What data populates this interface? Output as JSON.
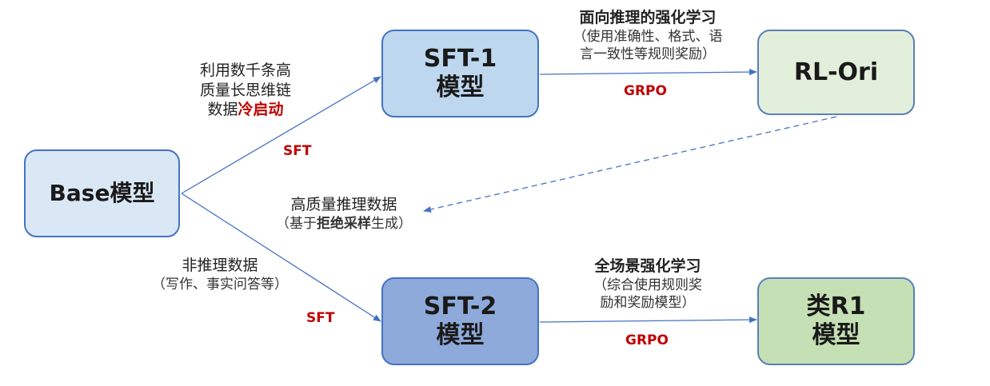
{
  "nodes": {
    "base": {
      "label": "Base模型"
    },
    "sft1": {
      "line1": "SFT-1",
      "line2": "模型"
    },
    "sft2": {
      "line1": "SFT-2",
      "line2": "模型"
    },
    "rl_ori": {
      "label": "RL-Ori"
    },
    "r1_like": {
      "line1": "类R1",
      "line2": "模型"
    }
  },
  "edges": {
    "base_to_sft1": {
      "line1": "利用数千条高",
      "line2": "质量长思维链",
      "line3_prefix": "数据",
      "line3_highlight": "冷启动",
      "method": "SFT"
    },
    "sft1_to_rlori": {
      "title": "面向推理的强化学习",
      "line1": "（使用准确性、格式、语",
      "line2": "言一致性等规则奖励）",
      "method": "GRPO"
    },
    "rlori_to_data": {
      "line1": "高质量推理数据",
      "line2_prefix": "（基于",
      "line2_bold": "拒绝采样",
      "line2_suffix": "生成）"
    },
    "base_to_sft2": {
      "line1": "非推理数据",
      "line2": "（写作、事实问答等）",
      "method": "SFT"
    },
    "sft2_to_r1": {
      "title": "全场景强化学习",
      "line1": "（综合使用规则奖",
      "line2": "励和奖励模型）",
      "method": "GRPO"
    }
  },
  "colors": {
    "border": "#4472c4",
    "arrow": "#4472c4",
    "highlight": "#c00000",
    "base_fill": "#dae8f6",
    "sft1_fill": "#bdd7ee",
    "sft2_fill": "#8eaadb",
    "rlori_fill": "#e2efda",
    "r1_fill": "#c5e0b4"
  }
}
